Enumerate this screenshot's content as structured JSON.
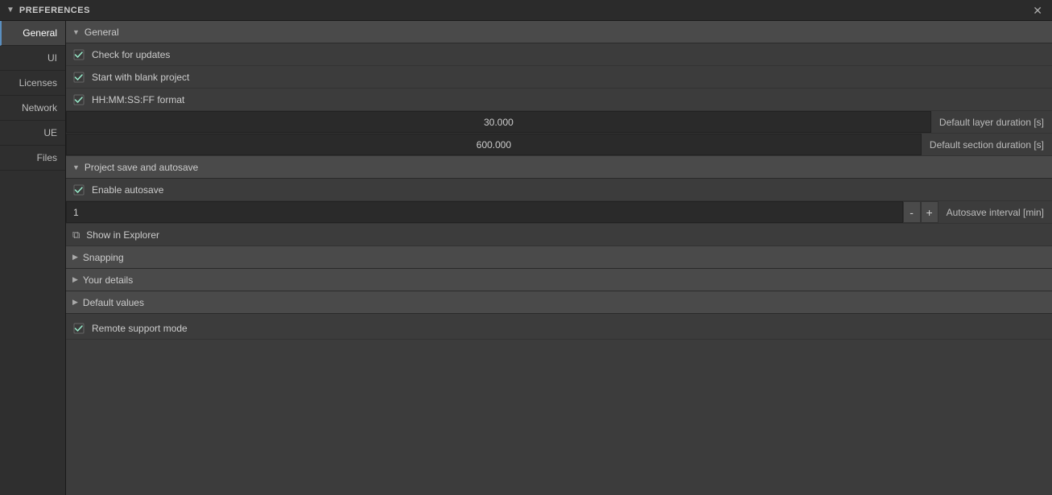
{
  "titleBar": {
    "triangle": "▼",
    "title": "PREFERENCES",
    "closeBtn": "✕"
  },
  "sidebar": {
    "items": [
      {
        "id": "general",
        "label": "General",
        "active": true
      },
      {
        "id": "ui",
        "label": "UI",
        "active": false
      },
      {
        "id": "licenses",
        "label": "Licenses",
        "active": false
      },
      {
        "id": "network",
        "label": "Network",
        "active": false
      },
      {
        "id": "ue",
        "label": "UE",
        "active": false
      },
      {
        "id": "files",
        "label": "Files",
        "active": false
      }
    ]
  },
  "content": {
    "generalSection": {
      "triangle": "▼",
      "title": "General"
    },
    "checkboxRows": [
      {
        "id": "check-updates",
        "label": "Check for updates",
        "checked": true
      },
      {
        "id": "blank-project",
        "label": "Start with blank project",
        "checked": true
      },
      {
        "id": "hhmm-format",
        "label": "HH:MM:SS:FF format",
        "checked": true
      }
    ],
    "inputRows": [
      {
        "id": "layer-duration",
        "value": "30.000",
        "label": "Default layer duration [s]"
      },
      {
        "id": "section-duration",
        "value": "600.000",
        "label": "Default section duration [s]"
      }
    ],
    "projectSaveSection": {
      "triangle": "▼",
      "title": "Project save and autosave"
    },
    "autosaveCheck": {
      "label": "Enable autosave",
      "checked": true
    },
    "autosaveInterval": {
      "value": "1",
      "minusBtn": "-",
      "plusBtn": "+",
      "label": "Autosave interval [min]"
    },
    "explorerRow": {
      "icon": "⧉",
      "label": "Show in Explorer"
    },
    "collapsedSections": [
      {
        "id": "snapping",
        "triangle": "▶",
        "title": "Snapping"
      },
      {
        "id": "your-details",
        "triangle": "▶",
        "title": "Your details"
      },
      {
        "id": "default-values",
        "triangle": "▶",
        "title": "Default values"
      }
    ],
    "remoteSupport": {
      "label": "Remote support mode",
      "checked": true
    }
  }
}
